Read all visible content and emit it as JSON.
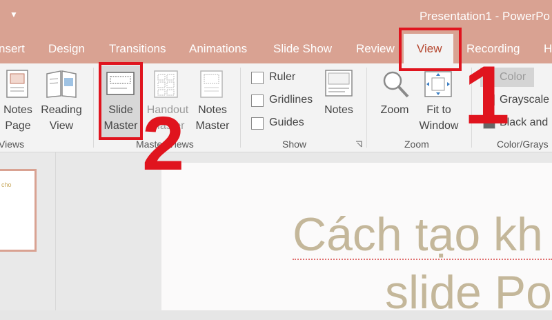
{
  "window": {
    "title": "Presentation1  -  PowerPo",
    "qat_icon": "▼"
  },
  "tabs": [
    {
      "label": "nsert"
    },
    {
      "label": "Design"
    },
    {
      "label": "Transitions"
    },
    {
      "label": "Animations"
    },
    {
      "label": "Slide Show"
    },
    {
      "label": "Review"
    },
    {
      "label": "View",
      "active": true
    },
    {
      "label": "Recording"
    },
    {
      "label": "H"
    }
  ],
  "ribbon": {
    "presentation_views": {
      "notes_page": {
        "line1": "Notes",
        "line2": "Page"
      },
      "reading_view": {
        "line1": "Reading",
        "line2": "View"
      },
      "group_label": "Views"
    },
    "master_views": {
      "slide_master": {
        "line1": "Slide",
        "line2": "Master"
      },
      "handout_master": {
        "line1": "Handout",
        "line2": "Master"
      },
      "notes_master": {
        "line1": "Notes",
        "line2": "Master"
      },
      "group_label": "Master Views"
    },
    "show": {
      "ruler": "Ruler",
      "gridlines": "Gridlines",
      "guides": "Guides",
      "notes": "Notes",
      "group_label": "Show"
    },
    "zoom": {
      "zoom": "Zoom",
      "fit_to_window": {
        "line1": "Fit to",
        "line2": "Window"
      },
      "group_label": "Zoom"
    },
    "color_grayscale": {
      "color": "Color",
      "grayscale": "Grayscale",
      "black_and_white": "Black and",
      "group_label": "Color/Grays"
    }
  },
  "thumbnail": {
    "text": "cho"
  },
  "slide": {
    "title": "Cách tạo kh",
    "subtitle": "slide Po"
  },
  "annotations": {
    "step1": "1",
    "step2": "2"
  },
  "colors": {
    "accent": "#d9a292",
    "highlight": "#e0141e",
    "active_tab_text": "#b5472f"
  }
}
